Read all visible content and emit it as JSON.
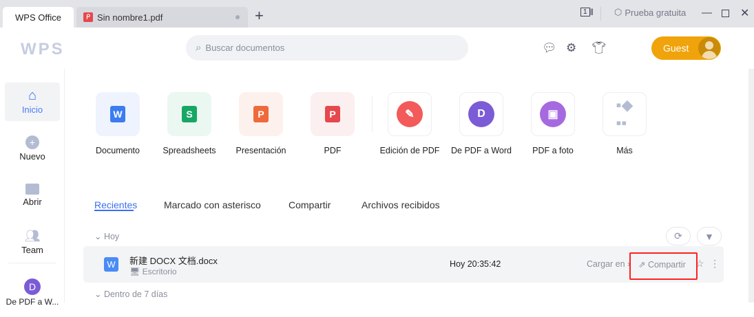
{
  "titlebar": {
    "tabs": [
      {
        "label": "WPS Office"
      },
      {
        "label": "Sin nombre1.pdf"
      }
    ],
    "new_tab": "+",
    "window_count": "1",
    "trial": "Prueba gratuita"
  },
  "header": {
    "logo": "WPS",
    "search_placeholder": "Buscar documentos",
    "user": "Guest"
  },
  "sidebar": {
    "items": [
      {
        "label": "Inicio"
      },
      {
        "label": "Nuevo"
      },
      {
        "label": "Abrir"
      },
      {
        "label": "Team"
      },
      {
        "label": "De PDF a W..."
      }
    ]
  },
  "tiles": [
    {
      "label": "Documento",
      "letter": "W",
      "color": "#3b7cf0"
    },
    {
      "label": "Spreadsheets",
      "letter": "S",
      "color": "#17a765"
    },
    {
      "label": "Presentación",
      "letter": "P",
      "color": "#ef6a3a"
    },
    {
      "label": "PDF",
      "letter": "P",
      "color": "#e5484d"
    },
    {
      "label": "Edición de PDF",
      "color": "#f35a5a"
    },
    {
      "label": "De PDF a Word",
      "color": "#7b5cd6"
    },
    {
      "label": "PDF a foto",
      "color": "#a66ae0"
    },
    {
      "label": "Más"
    }
  ],
  "nav_tabs": [
    {
      "label": "Recientes"
    },
    {
      "label": "Marcado con asterisco"
    },
    {
      "label": "Compartir"
    },
    {
      "label": "Archivos recibidos"
    }
  ],
  "sections": {
    "today": "Hoy",
    "week": "Dentro de 7 días"
  },
  "files": [
    {
      "name": "新建 DOCX 文档.docx",
      "location": "Escritorio",
      "time": "Hoy 20:35:42",
      "upload": "Cargar en",
      "share": "Compartir"
    }
  ],
  "highlight_color": "#ff2020"
}
